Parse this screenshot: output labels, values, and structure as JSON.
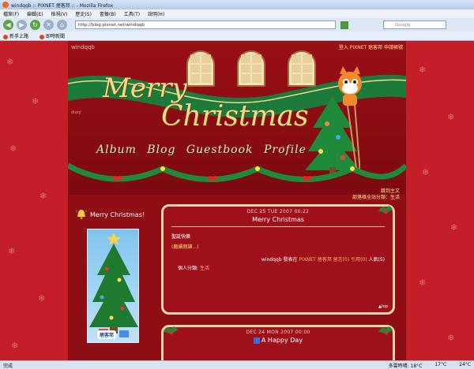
{
  "window": {
    "title": "windqqb :: PIXNET 痞客邦 :: - Mozilla Firefox"
  },
  "menu": [
    "檔案(F)",
    "編輯(E)",
    "檢視(V)",
    "歷史(S)",
    "書籤(B)",
    "工具(T)",
    "說明(H)"
  ],
  "nav": {
    "url": "http://blog.pixnet.net/windqqb",
    "search_placeholder": "Google"
  },
  "bookmarks": [
    "新手上路",
    "即時新聞"
  ],
  "blog": {
    "name": "windqqb",
    "top_links": "登入 PIXNET 痞客邦 申請帳號",
    "diary": "diary",
    "merry": "Merry",
    "christmas": "Christmas",
    "nav_items": [
      "Album",
      "Blog",
      "Guestbook",
      "Profile"
    ],
    "sub_links": [
      "跳到主文",
      "部落格全站分類：生活"
    ]
  },
  "sidebar": {
    "title": "Merry Christmas!",
    "logo": "痞客邦"
  },
  "posts": [
    {
      "date": "DEC 25 TUE 2007 00:22",
      "title": "Merry Christmas",
      "body": "聖誕快樂",
      "more": "(繼續閱讀...)",
      "meta_author": "windqqb",
      "meta_text1": "發表在",
      "meta_site": "PIXNET 痞客邦",
      "meta_comments": "留言(0)",
      "meta_trackback": "引用(0)",
      "meta_views": "人氣(5)",
      "cat_label": "個人分類:",
      "cat_value": "生活",
      "top": "▲top"
    },
    {
      "date": "DEC 24 MON 2007 00:00",
      "title": "A Happy Day"
    }
  ],
  "status": {
    "left": "完成",
    "right1": "多雲時晴: 18°C",
    "right2": "17°C",
    "right3": "24°C"
  },
  "colors": {
    "page_bg": "#c41f28",
    "content_bg": "#8e0e14",
    "accent": "#ffe08a",
    "frame": "#f0d6a8"
  }
}
